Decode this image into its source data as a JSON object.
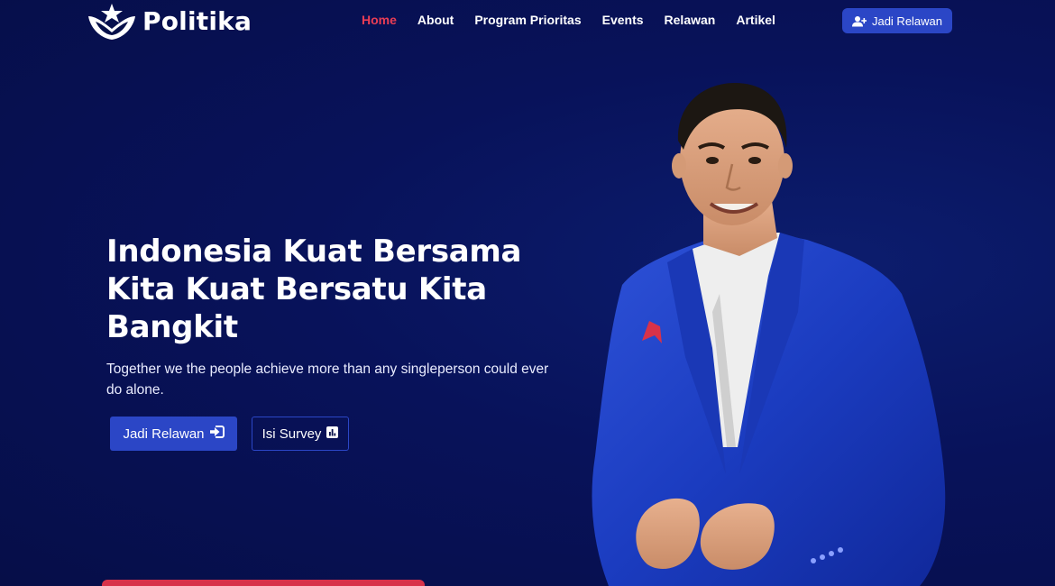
{
  "brand": {
    "name": "Politika"
  },
  "nav": {
    "items": [
      {
        "label": "Home",
        "active": true
      },
      {
        "label": "About",
        "active": false
      },
      {
        "label": "Program Prioritas",
        "active": false
      },
      {
        "label": "Events",
        "active": false
      },
      {
        "label": "Relawan",
        "active": false
      },
      {
        "label": "Artikel",
        "active": false
      }
    ],
    "cta_label": "Jadi Relawan"
  },
  "hero": {
    "title_line1": "Indonesia Kuat Bersama",
    "title_line2": "Kita Kuat Bersatu Kita",
    "title_line3": "Bangkit",
    "subtitle": "Together we the people achieve more than any singleperson could ever do alone.",
    "primary_button": "Jadi Relawan",
    "secondary_button": "Isi Survey"
  },
  "colors": {
    "background": "#07104a",
    "accent_blue": "#2b46c6",
    "accent_red": "#ea3d55"
  },
  "icons": {
    "logo": "eagle-star-logo-icon",
    "nav_cta": "user-plus-icon",
    "primary_button": "sign-in-icon",
    "secondary_button": "bar-chart-icon"
  }
}
